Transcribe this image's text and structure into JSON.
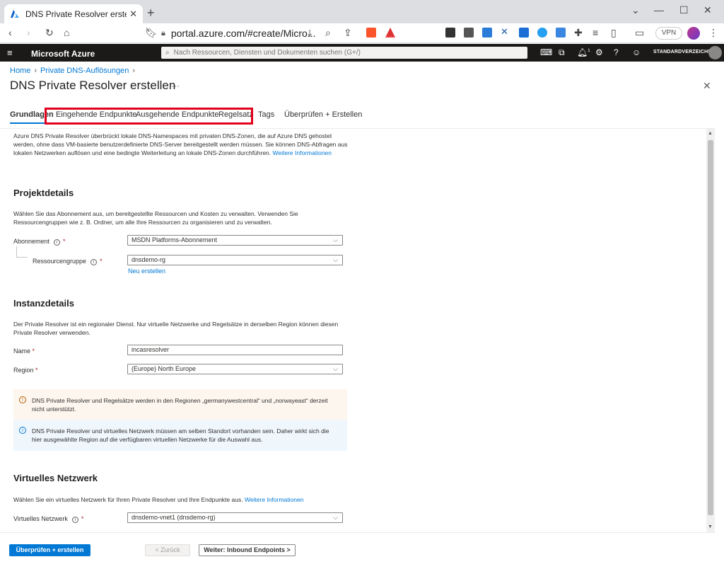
{
  "browser": {
    "tab_title": "DNS Private Resolver erstellen - Micr",
    "url": "portal.azure.com/#create/Micro...",
    "vpn_label": "VPN"
  },
  "azure_header": {
    "brand": "Microsoft Azure",
    "search_placeholder": "Nach Ressourcen, Diensten und Dokumenten suchen (G+/)",
    "notification_count": "1",
    "directory": "STANDARDVERZEICHNIS"
  },
  "breadcrumb": {
    "home": "Home",
    "parent": "Private DNS-Auflösungen"
  },
  "page": {
    "title": "DNS Private Resolver erstellen",
    "more": "···"
  },
  "tabs": [
    {
      "label": "Grundlagen"
    },
    {
      "label": "Eingehende Endpunkte"
    },
    {
      "label": "Ausgehende Endpunkte"
    },
    {
      "label": "Regelsatz"
    },
    {
      "label": "Tags"
    },
    {
      "label": "Überprüfen + Erstellen"
    }
  ],
  "intro": {
    "text": "Azure DNS Private Resolver überbrückt lokale DNS-Namespaces mit privaten DNS-Zonen, die auf Azure DNS gehostet werden, ohne dass VM-basierte benutzerdefinierte DNS-Server bereitgestellt werden müssen. Sie können DNS-Abfragen aus lokalen Netzwerken auflösen und eine bedingte Weiterleitung an lokale DNS-Zonen durchführen.",
    "link": "Weitere Informationen"
  },
  "project": {
    "heading": "Projektdetails",
    "description": "Wählen Sie das Abonnement aus, um bereitgestellte Ressourcen und Kosten zu verwalten. Verwenden Sie Ressourcengruppen wie z. B. Ordner, um alle Ihre Ressourcen zu organisieren und zu verwalten.",
    "subscription_label": "Abonnement",
    "subscription_value": "MSDN Platforms-Abonnement",
    "rg_label": "Ressourcengruppe",
    "rg_value": "dnsdemo-rg",
    "new_link": "Neu erstellen"
  },
  "instance": {
    "heading": "Instanzdetails",
    "description": "Der Private Resolver ist ein regionaler Dienst. Nur virtuelle Netzwerke und Regelsätze in derselben Region können diesen Private Resolver verwenden.",
    "name_label": "Name",
    "name_value": "incasresolver",
    "region_label": "Region",
    "region_value": "(Europe) North Europe"
  },
  "messages": {
    "warning": "DNS Private Resolver und Regelsätze werden in den Regionen „germanywestcentral“ und „norwayeast“ derzeit nicht unterstützt.",
    "info": "DNS Private Resolver und virtuelles Netzwerk müssen am selben Standort vorhanden sein. Daher wirkt sich die hier ausgewählte Region auf die verfügbaren virtuellen Netzwerke für die Auswahl aus."
  },
  "vnet": {
    "heading": "Virtuelles Netzwerk",
    "description": "Wählen Sie ein virtuelles Netzwerk für Ihren Private Resolver und Ihre Endpunkte aus.",
    "link": "Weitere Informationen",
    "label": "Virtuelles Netzwerk",
    "value": "dnsdemo-vnet1 (dnsdemo-rg)"
  },
  "footer": {
    "review_button": "Überprüfen + erstellen",
    "back_button": "< Zurück",
    "next_button": "Weiter: Inbound Endpoints >"
  },
  "colors": {
    "accent": "#0078d4",
    "highlight_box": "#e0001b",
    "header_bg": "#1b1a19"
  }
}
